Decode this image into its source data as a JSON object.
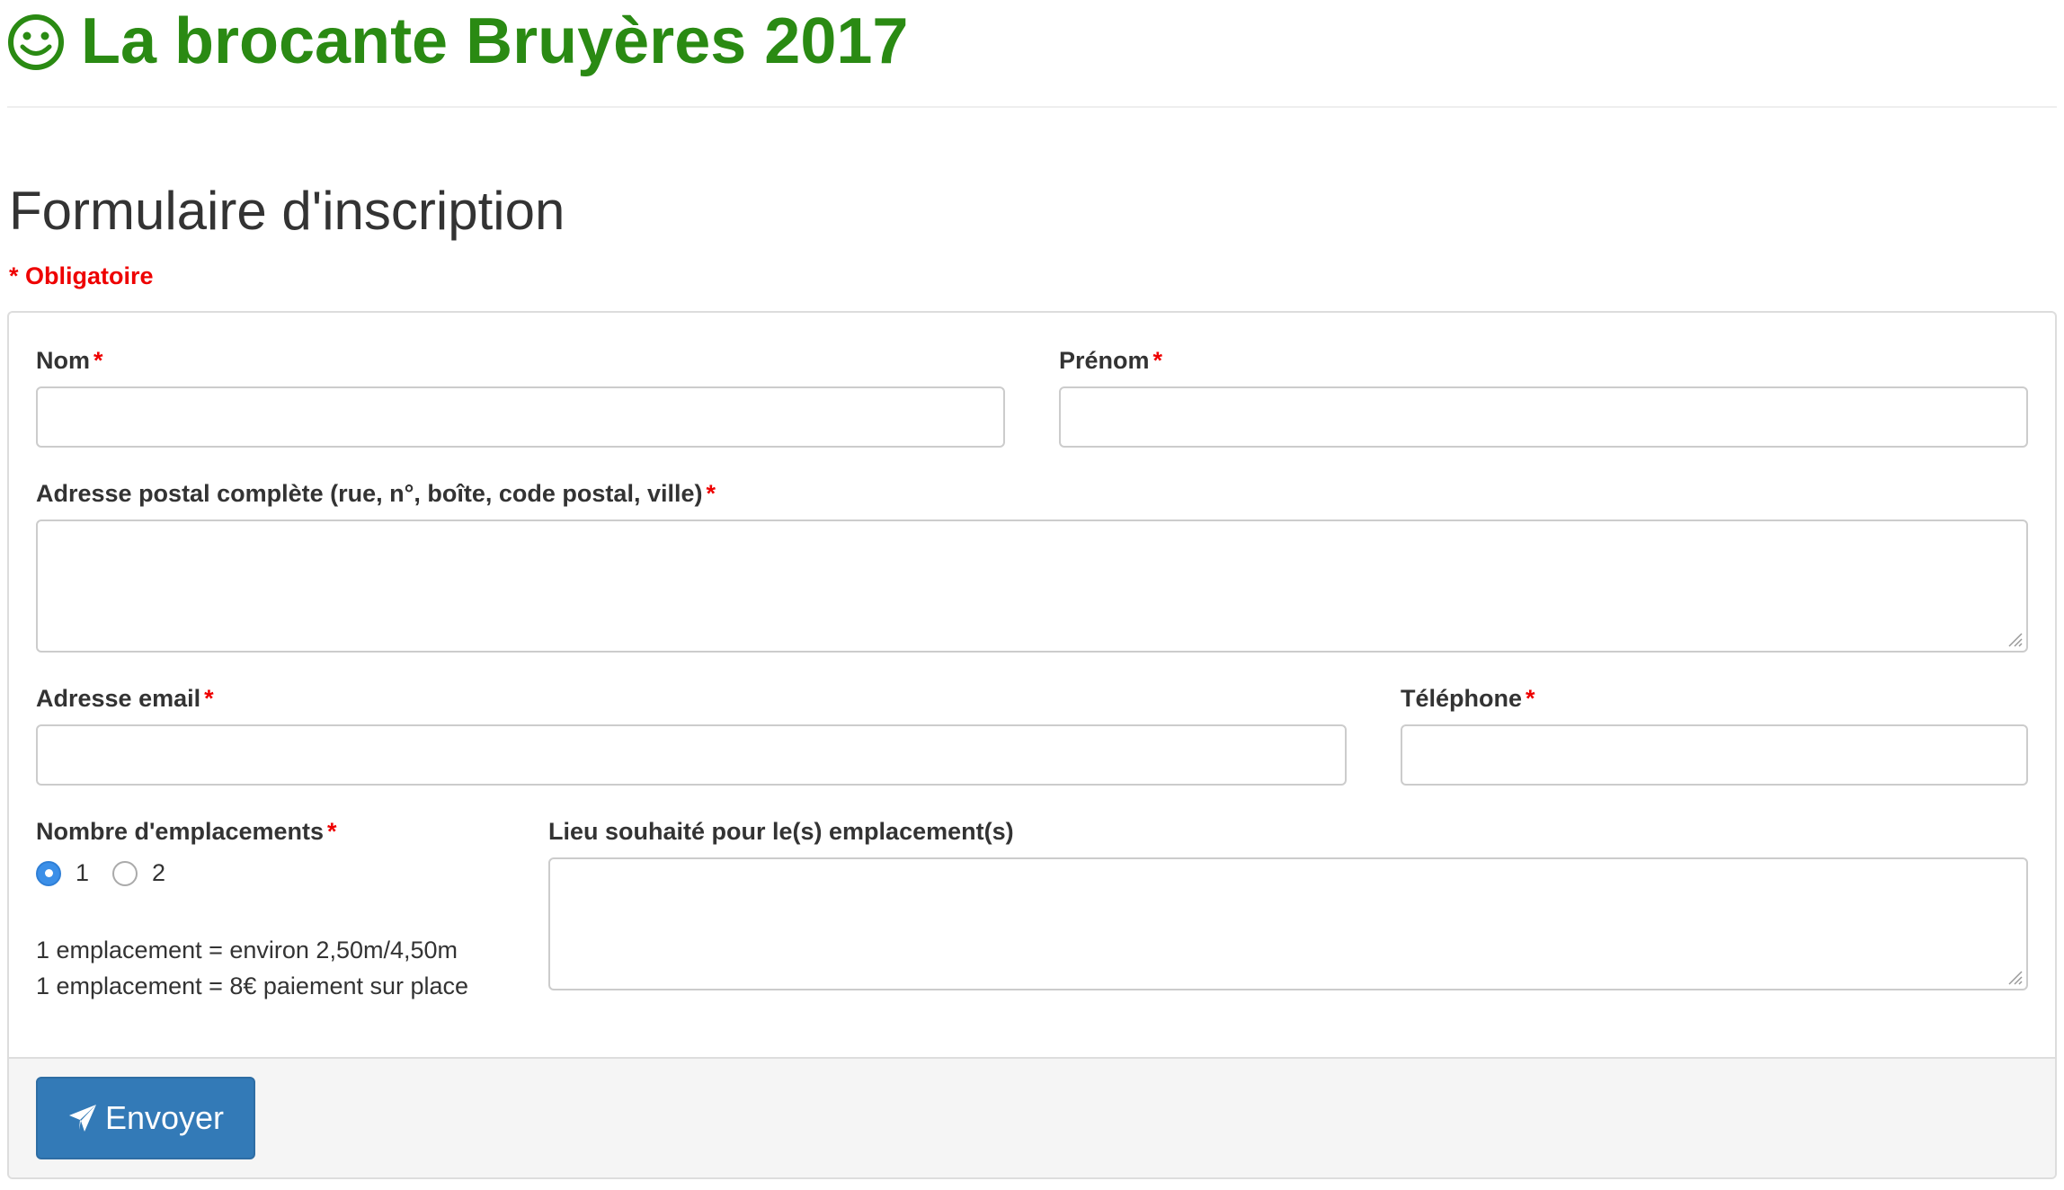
{
  "header": {
    "title": "La brocante Bruyères 2017",
    "icon": "smiley-icon",
    "title_color": "#2a8a13"
  },
  "form": {
    "title": "Formulaire d'inscription",
    "required_note": "* Obligatoire",
    "required_marker": "*",
    "fields": {
      "nom": {
        "label": "Nom",
        "value": "",
        "placeholder": ""
      },
      "prenom": {
        "label": "Prénom",
        "value": "",
        "placeholder": ""
      },
      "adresse": {
        "label": "Adresse postal complète (rue, n°, boîte, code postal, ville)",
        "value": ""
      },
      "email": {
        "label": "Adresse email",
        "value": "",
        "placeholder": ""
      },
      "telephone": {
        "label": "Téléphone",
        "value": "",
        "placeholder": ""
      },
      "emplacements": {
        "label": "Nombre d'emplacements",
        "options": [
          "1",
          "2"
        ],
        "selected": "1",
        "help": [
          "1 emplacement = environ 2,50m/4,50m",
          "1 emplacement = 8€ paiement sur place"
        ]
      },
      "lieu": {
        "label": "Lieu souhaité pour le(s) emplacement(s)",
        "value": ""
      }
    },
    "submit": {
      "label": "Envoyer",
      "icon": "send-icon",
      "color": "#337ab7"
    }
  }
}
